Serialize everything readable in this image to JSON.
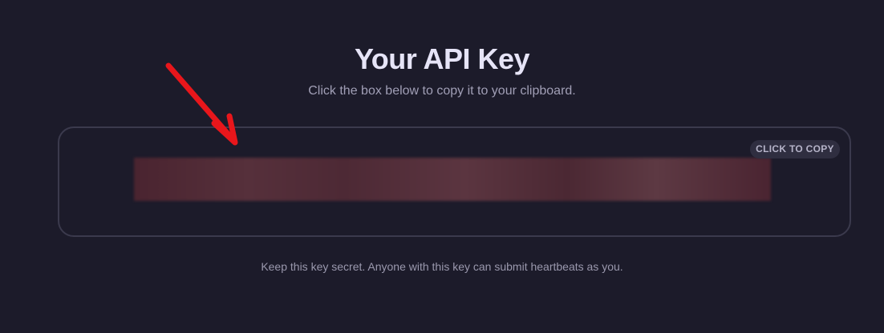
{
  "header": {
    "title": "Your API Key",
    "subtitle": "Click the box below to copy it to your clipboard."
  },
  "key_box": {
    "copy_label": "CLICK TO COPY",
    "key_value": ""
  },
  "footer": {
    "note": "Keep this key secret. Anyone with this key can submit heartbeats as you."
  },
  "colors": {
    "background": "#1c1b2a",
    "annotation_arrow": "#e8161b",
    "redacted_key": "#4f2a35"
  },
  "icons": {
    "annotation": "red-arrow-icon"
  }
}
